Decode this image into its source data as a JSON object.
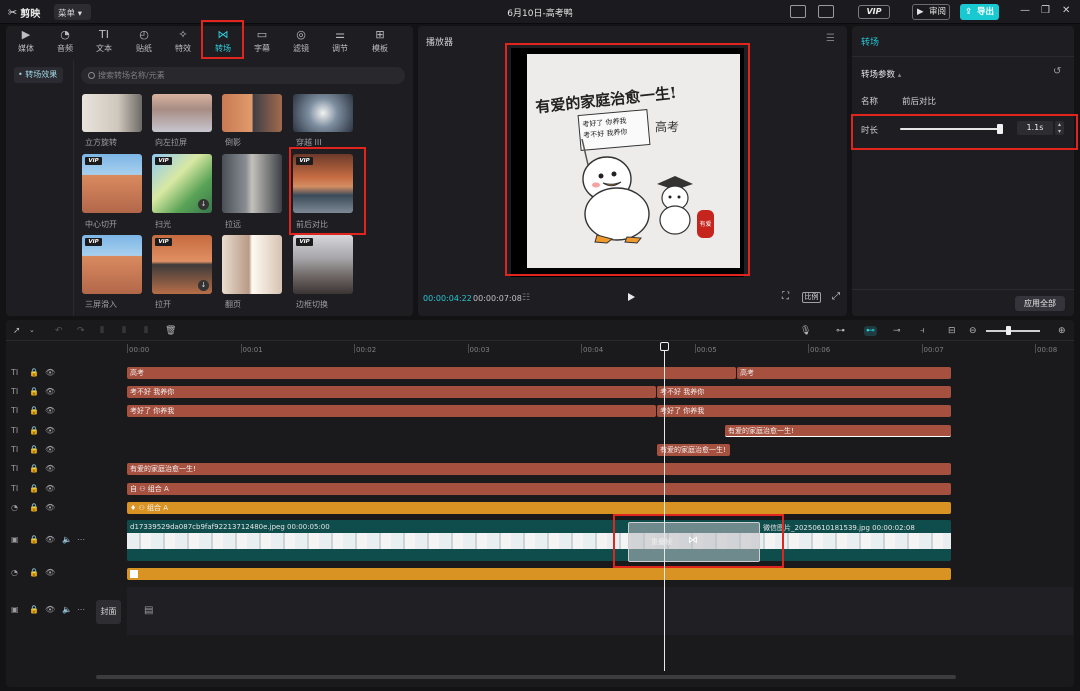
{
  "app": {
    "logo_text": "剪映",
    "menu_label": "菜单",
    "doc_title": "6月10日-高考鸭",
    "vip": "VIP",
    "review": "审阅",
    "export": "导出"
  },
  "tabs": [
    {
      "icon": "▶",
      "label": "媒体"
    },
    {
      "icon": "◔",
      "label": "音频"
    },
    {
      "icon": "TI",
      "label": "文本"
    },
    {
      "icon": "◴",
      "label": "贴纸"
    },
    {
      "icon": "✧",
      "label": "特效"
    },
    {
      "icon": "⋈",
      "label": "转场"
    },
    {
      "icon": "▭",
      "label": "字幕"
    },
    {
      "icon": "◎",
      "label": "滤镜"
    },
    {
      "icon": "⚌",
      "label": "调节"
    },
    {
      "icon": "⊞",
      "label": "模板"
    }
  ],
  "sidebar": {
    "selected": "转场效果"
  },
  "search": {
    "placeholder": "搜索转场名称/元素"
  },
  "transitions": [
    {
      "label": "立方旋转",
      "vip": false,
      "download": false
    },
    {
      "label": "向左拉屏",
      "vip": false,
      "download": false
    },
    {
      "label": "倒影",
      "vip": false,
      "download": false
    },
    {
      "label": "穿越 III",
      "vip": false,
      "download": false
    },
    {
      "label": "中心切开",
      "vip": true,
      "download": false
    },
    {
      "label": "扫光",
      "vip": true,
      "download": true
    },
    {
      "label": "拉远",
      "vip": false,
      "download": false
    },
    {
      "label": "前后对比",
      "vip": true,
      "download": false
    },
    {
      "label": "三屏滑入",
      "vip": true,
      "download": false
    },
    {
      "label": "拉开",
      "vip": true,
      "download": true
    },
    {
      "label": "翻页",
      "vip": false,
      "download": false
    },
    {
      "label": "边框切换",
      "vip": true,
      "download": false
    }
  ],
  "player": {
    "title": "播放器",
    "current_time": "00:00:04:22",
    "total_time": "00:00:07:08",
    "ratio_label": "比例",
    "poster_title": "有爱的家庭治愈一生!",
    "sign_line1": "考好了 你养我",
    "sign_line2": "考不好 我养你",
    "side_text": "高考",
    "stamp_text": "有爱"
  },
  "right_panel": {
    "title": "转场",
    "section": "转场参数",
    "name_label": "名称",
    "name_value": "前后对比",
    "duration_label": "时长",
    "duration_value": "1.1s",
    "duration_fraction": 0.97,
    "apply_all": "应用全部"
  },
  "ruler": [
    "00:00",
    "00:01",
    "00:02",
    "00:03",
    "00:04",
    "00:05",
    "00:06",
    "00:07",
    "00:08"
  ],
  "tracks": {
    "t1a": "高考",
    "t1b": "高考",
    "t2a": "考不好 我养你",
    "t2b": "考不好 我养你",
    "t3a": "考好了 你养我",
    "t3b": "考好了 你养我",
    "t4": "有爱的家庭治愈一生!",
    "t5": "有爱的家庭治愈一生!",
    "t6": "有爱的家庭治愈一生!",
    "t7": "组合 A",
    "t8": "组合 A",
    "video1": "d17339529da087cb9faf92213712480e.jpeg  00:00:05:00",
    "video2": "微信图片_20250610181539.jpg  00:00:02:08",
    "transition_label": "重叠帧",
    "cover": "封面"
  },
  "colors": {
    "accent": "#2dd0de",
    "text_clip": "#a6503f",
    "orange_clip": "#d89323",
    "highlight": "#e0241e"
  }
}
